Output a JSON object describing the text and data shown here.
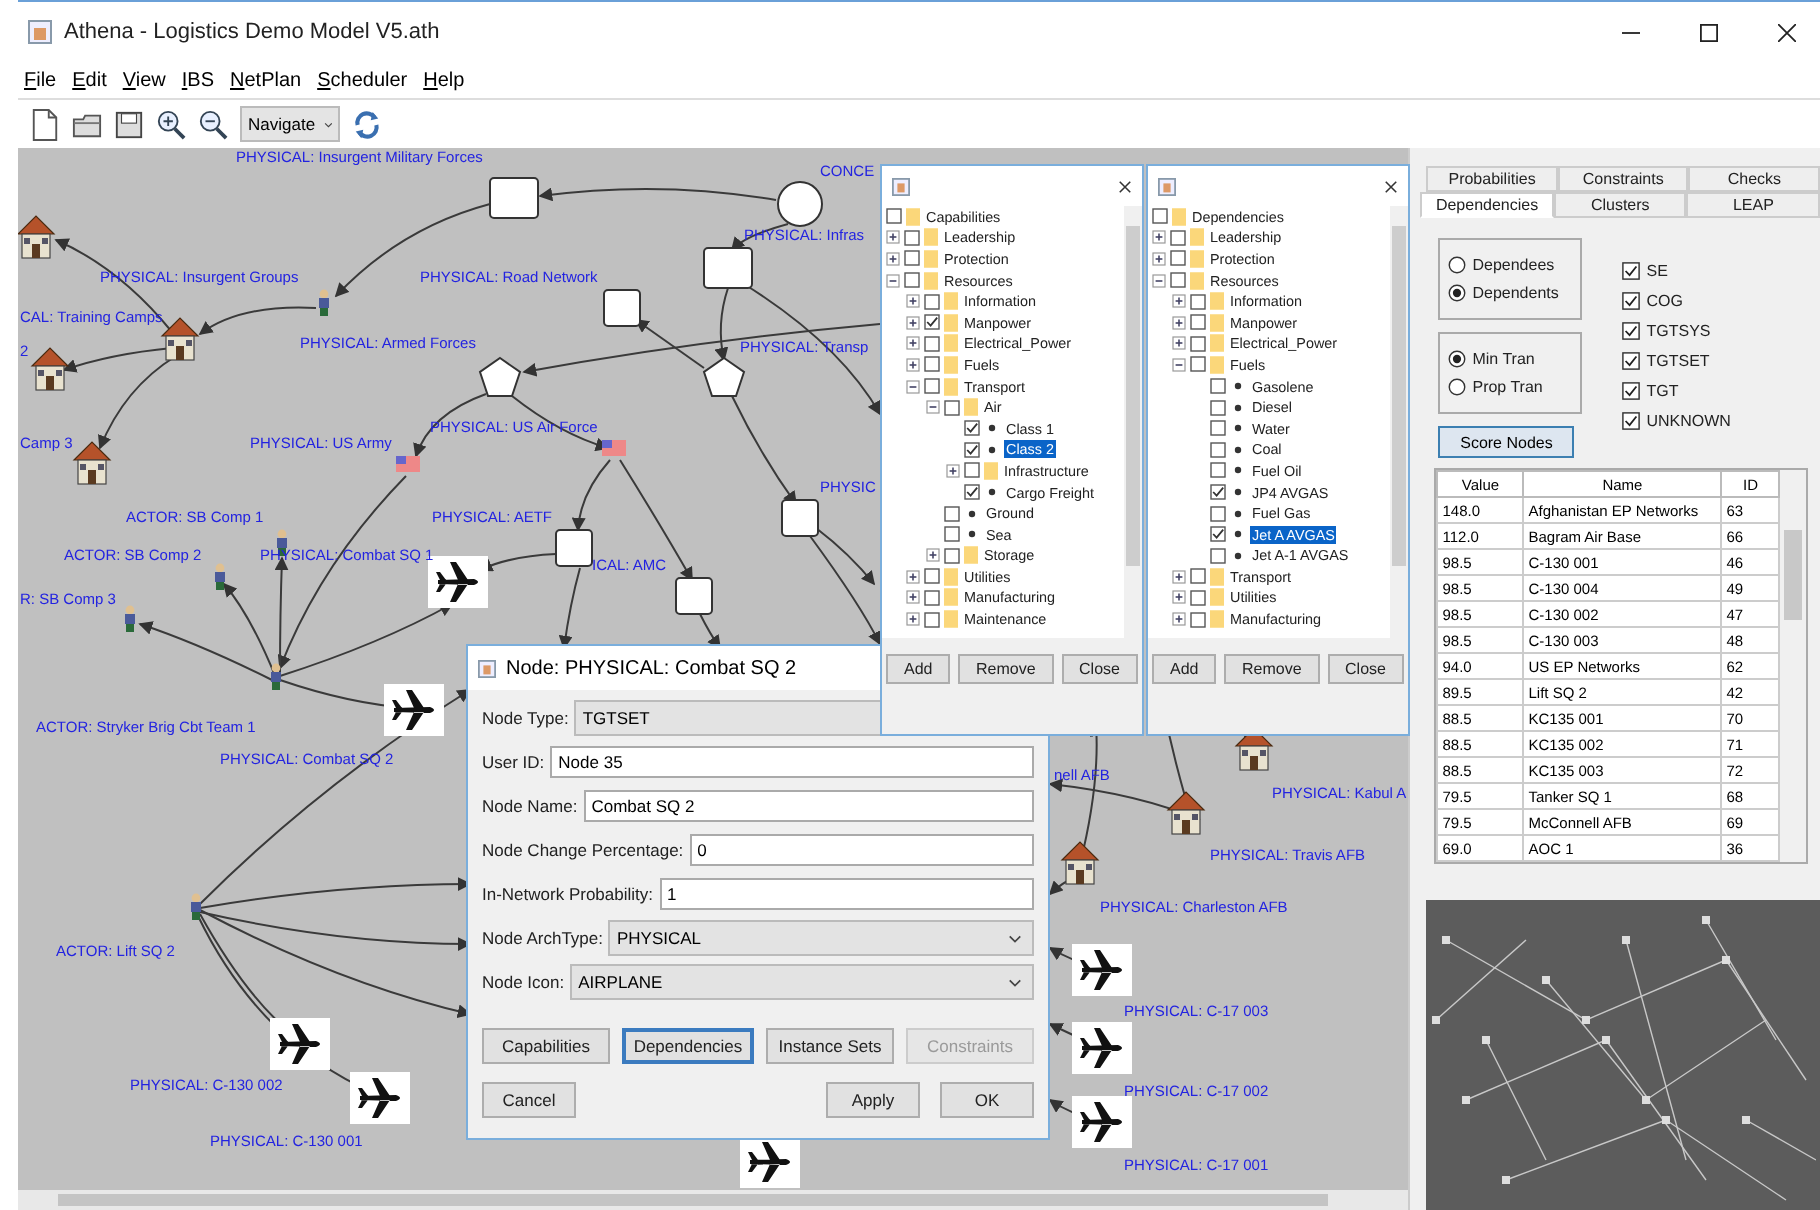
{
  "window": {
    "title": "Athena - Logistics Demo Model V5.ath"
  },
  "menu": [
    "File",
    "Edit",
    "View",
    "IBS",
    "NetPlan",
    "Scheduler",
    "Help"
  ],
  "toolbar": {
    "mode": "Navigate"
  },
  "canvas": {
    "labels": [
      "PHYSICAL: Insurgent Military Forces",
      "CONCE",
      "PHYSICAL: Infras",
      "PHYSICAL: Insurgent Groups",
      "PHYSICAL: Road Network",
      "CAL: Training Camps",
      "2",
      "PHYSICAL: Armed Forces",
      "PHYSICAL: Transp",
      "PHYSICAL: US Air Force",
      "Camp 3",
      "PHYSICAL: US Army",
      "PHYSIC",
      "ACTOR: SB Comp 1",
      "PHYSICAL: AETF",
      "ACTOR: SB Comp 2",
      "PHYSICAL: Combat SQ 1",
      "ICAL: AMC",
      "R: SB Comp 3",
      "ACTOR: Stryker Brig Cbt Team 1",
      "PHYSICAL: Combat SQ 2",
      "nell AFB",
      "PHYSICAL: Kabul A",
      "PHYSICAL: Travis AFB",
      "PHYSICAL: Charleston AFB",
      "ACTOR: Lift SQ 2",
      "PHYSICAL: C-17 003",
      "PHYSICAL: C-130 002",
      "PHYSICAL: C-17 002",
      "PHYSICAL: C-130 001",
      "PHYSICAL: C-17 001"
    ]
  },
  "side_panel": {
    "tab_rows": [
      [
        {
          "label": "Probabilities",
          "selected": false
        },
        {
          "label": "Constraints",
          "selected": false
        },
        {
          "label": "Checks",
          "selected": false
        }
      ],
      [
        {
          "label": "Dependencies",
          "selected": true
        },
        {
          "label": "Clusters",
          "selected": false
        },
        {
          "label": "LEAP",
          "selected": false
        }
      ]
    ],
    "direction": [
      {
        "label": "Dependees",
        "selected": false
      },
      {
        "label": "Dependents",
        "selected": true
      }
    ],
    "transitivity": [
      {
        "label": "Min Tran",
        "selected": true
      },
      {
        "label": "Prop Tran",
        "selected": false
      }
    ],
    "types": [
      {
        "label": "SE",
        "checked": true
      },
      {
        "label": "COG",
        "checked": true
      },
      {
        "label": "TGTSYS",
        "checked": true
      },
      {
        "label": "TGTSET",
        "checked": true
      },
      {
        "label": "TGT",
        "checked": true
      },
      {
        "label": "UNKNOWN",
        "checked": true
      }
    ],
    "score_button": "Score Nodes",
    "table": {
      "columns": [
        "Value",
        "Name",
        "ID"
      ],
      "rows": [
        [
          "148.0",
          "Afghanistan EP Networks",
          "63"
        ],
        [
          "112.0",
          "Bagram Air Base",
          "66"
        ],
        [
          "98.5",
          "C-130 001",
          "46"
        ],
        [
          "98.5",
          "C-130 004",
          "49"
        ],
        [
          "98.5",
          "C-130 002",
          "47"
        ],
        [
          "98.5",
          "C-130 003",
          "48"
        ],
        [
          "94.0",
          "US EP Networks",
          "62"
        ],
        [
          "89.5",
          "Lift SQ 2",
          "42"
        ],
        [
          "88.5",
          "KC135 001",
          "70"
        ],
        [
          "88.5",
          "KC135 002",
          "71"
        ],
        [
          "88.5",
          "KC135 003",
          "72"
        ],
        [
          "79.5",
          "Tanker SQ 1",
          "68"
        ],
        [
          "79.5",
          "McConnell AFB",
          "69"
        ],
        [
          "69.0",
          "AOC 1",
          "36"
        ]
      ]
    }
  },
  "capabilities_dialog": {
    "tree": {
      "kind": "root",
      "label": "Capabilities",
      "checked": false,
      "selected": false,
      "children": [
        {
          "kind": "folder",
          "label": "Leadership",
          "expanded": false,
          "checked": false,
          "selected": false
        },
        {
          "kind": "folder",
          "label": "Protection",
          "expanded": false,
          "checked": false,
          "selected": false
        },
        {
          "kind": "folder",
          "label": "Resources",
          "expanded": true,
          "checked": false,
          "selected": false,
          "children": [
            {
              "kind": "folder",
              "label": "Information",
              "expanded": false,
              "checked": false,
              "selected": false
            },
            {
              "kind": "folder",
              "label": "Manpower",
              "expanded": false,
              "checked": true,
              "selected": false
            },
            {
              "kind": "folder",
              "label": "Electrical_Power",
              "expanded": false,
              "checked": false,
              "selected": false
            },
            {
              "kind": "folder",
              "label": "Fuels",
              "expanded": false,
              "checked": false,
              "selected": false
            },
            {
              "kind": "folder",
              "label": "Transport",
              "expanded": true,
              "checked": false,
              "selected": false,
              "children": [
                {
                  "kind": "folder",
                  "label": "Air",
                  "expanded": true,
                  "checked": false,
                  "selected": false,
                  "children": [
                    {
                      "kind": "item",
                      "label": "Class 1",
                      "checked": true,
                      "selected": false
                    },
                    {
                      "kind": "item",
                      "label": "Class 2",
                      "checked": true,
                      "selected": true
                    },
                    {
                      "kind": "folder",
                      "label": "Infrastructure",
                      "expanded": false,
                      "checked": false,
                      "selected": false
                    },
                    {
                      "kind": "item",
                      "label": "Cargo Freight",
                      "checked": true,
                      "selected": false
                    }
                  ]
                },
                {
                  "kind": "item",
                  "label": "Ground",
                  "checked": false,
                  "selected": false
                },
                {
                  "kind": "item",
                  "label": "Sea",
                  "checked": false,
                  "selected": false
                },
                {
                  "kind": "folder",
                  "label": "Storage",
                  "expanded": false,
                  "checked": false,
                  "selected": false
                }
              ]
            },
            {
              "kind": "folder",
              "label": "Utilities",
              "expanded": false,
              "checked": false,
              "selected": false
            },
            {
              "kind": "folder",
              "label": "Manufacturing",
              "expanded": false,
              "checked": false,
              "selected": false
            },
            {
              "kind": "folder",
              "label": "Maintenance",
              "expanded": false,
              "checked": false,
              "selected": false
            }
          ]
        }
      ]
    },
    "buttons": [
      "Add",
      "Remove",
      "Close"
    ]
  },
  "dependencies_dialog": {
    "tree": {
      "kind": "root",
      "label": "Dependencies",
      "checked": false,
      "selected": false,
      "children": [
        {
          "kind": "folder",
          "label": "Leadership",
          "expanded": false,
          "checked": false,
          "selected": false
        },
        {
          "kind": "folder",
          "label": "Protection",
          "expanded": false,
          "checked": false,
          "selected": false
        },
        {
          "kind": "folder",
          "label": "Resources",
          "expanded": true,
          "checked": false,
          "selected": false,
          "children": [
            {
              "kind": "folder",
              "label": "Information",
              "expanded": false,
              "checked": false,
              "selected": false
            },
            {
              "kind": "folder",
              "label": "Manpower",
              "expanded": false,
              "checked": false,
              "selected": false
            },
            {
              "kind": "folder",
              "label": "Electrical_Power",
              "expanded": false,
              "checked": false,
              "selected": false
            },
            {
              "kind": "folder",
              "label": "Fuels",
              "expanded": true,
              "checked": false,
              "selected": false,
              "children": [
                {
                  "kind": "item",
                  "label": "Gasolene",
                  "checked": false,
                  "selected": false
                },
                {
                  "kind": "item",
                  "label": "Diesel",
                  "checked": false,
                  "selected": false
                },
                {
                  "kind": "item",
                  "label": "Water",
                  "checked": false,
                  "selected": false
                },
                {
                  "kind": "item",
                  "label": "Coal",
                  "checked": false,
                  "selected": false
                },
                {
                  "kind": "item",
                  "label": "Fuel Oil",
                  "checked": false,
                  "selected": false
                },
                {
                  "kind": "item",
                  "label": "JP4 AVGAS",
                  "checked": true,
                  "selected": false
                },
                {
                  "kind": "item",
                  "label": "Fuel Gas",
                  "checked": false,
                  "selected": false
                },
                {
                  "kind": "item",
                  "label": "Jet A AVGAS",
                  "checked": true,
                  "selected": true
                },
                {
                  "kind": "item",
                  "label": "Jet A-1 AVGAS",
                  "checked": false,
                  "selected": false
                }
              ]
            },
            {
              "kind": "folder",
              "label": "Transport",
              "expanded": false,
              "checked": false,
              "selected": false
            },
            {
              "kind": "folder",
              "label": "Utilities",
              "expanded": false,
              "checked": false,
              "selected": false
            },
            {
              "kind": "folder",
              "label": "Manufacturing",
              "expanded": false,
              "checked": false,
              "selected": false
            }
          ]
        }
      ]
    },
    "buttons": [
      "Add",
      "Remove",
      "Close"
    ]
  },
  "node_dialog": {
    "title": "Node: PHYSICAL: Combat SQ 2",
    "fields": [
      {
        "kind": "dropdown",
        "label": "Node Type:",
        "value": "TGTSET"
      },
      {
        "kind": "text",
        "label": "User ID:",
        "value": "Node 35"
      },
      {
        "kind": "text",
        "label": "Node Name:",
        "value": "Combat SQ 2"
      },
      {
        "kind": "text",
        "label": "Node Change Percentage:",
        "value": "0"
      },
      {
        "kind": "text",
        "label": "In-Network Probability:",
        "value": "1"
      },
      {
        "kind": "dropdown",
        "label": "Node ArchType:",
        "value": "PHYSICAL"
      },
      {
        "kind": "dropdown",
        "label": "Node Icon:",
        "value": "AIRPLANE"
      }
    ],
    "buttons": [
      {
        "label": "Capabilities",
        "focused": false,
        "disabled": false
      },
      {
        "label": "Dependencies",
        "focused": true,
        "disabled": false
      },
      {
        "label": "Instance Sets",
        "focused": false,
        "disabled": false
      },
      {
        "label": "Constraints",
        "focused": false,
        "disabled": true
      }
    ],
    "footer_buttons": [
      "Cancel",
      "Apply",
      "OK"
    ]
  }
}
